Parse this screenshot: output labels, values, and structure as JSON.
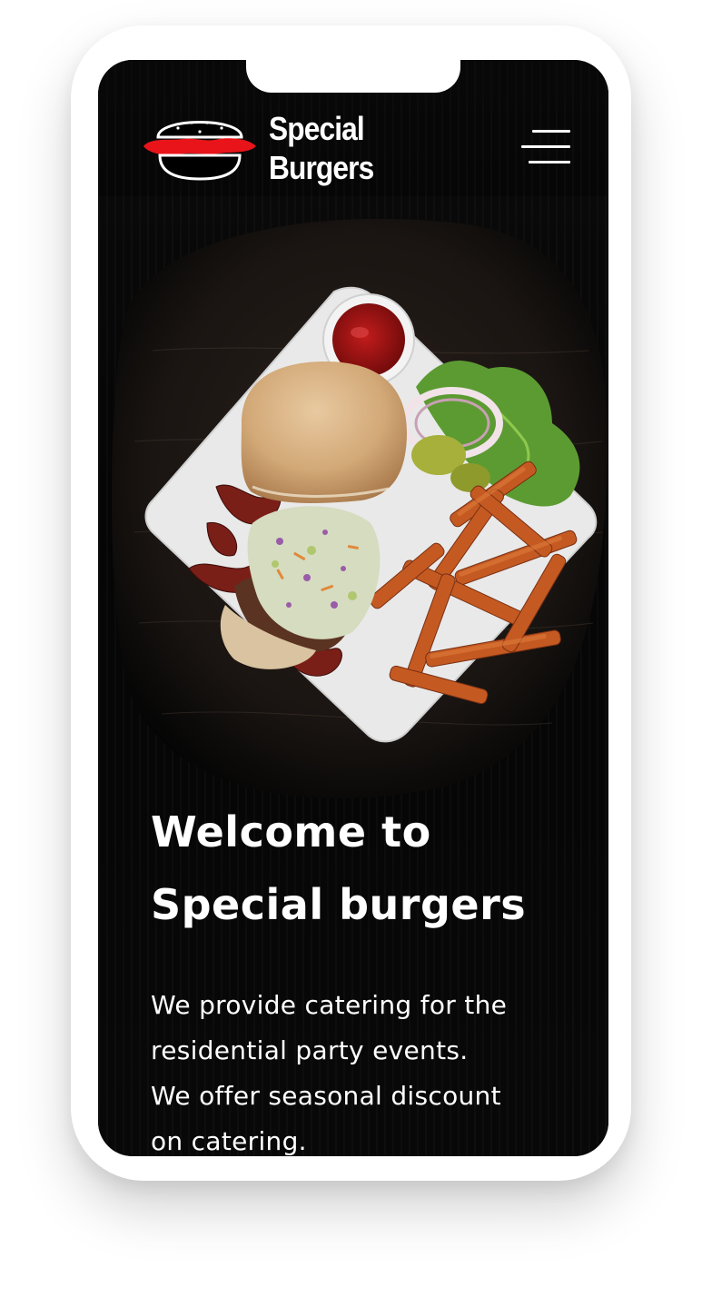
{
  "brand": {
    "line1": "Special",
    "line2": "Burgers",
    "logo_icon": "burger-icon",
    "accent_color": "#e8141a"
  },
  "nav": {
    "menu_icon": "hamburger-menu-icon"
  },
  "hero": {
    "image_subject": "burger-with-fries-plate-image",
    "heading_line1": "Welcome to",
    "heading_line2": "Special burgers",
    "paragraph_lines": [
      "We provide catering for the",
      "residential party events.",
      "We offer seasonal discount",
      "on catering."
    ]
  }
}
